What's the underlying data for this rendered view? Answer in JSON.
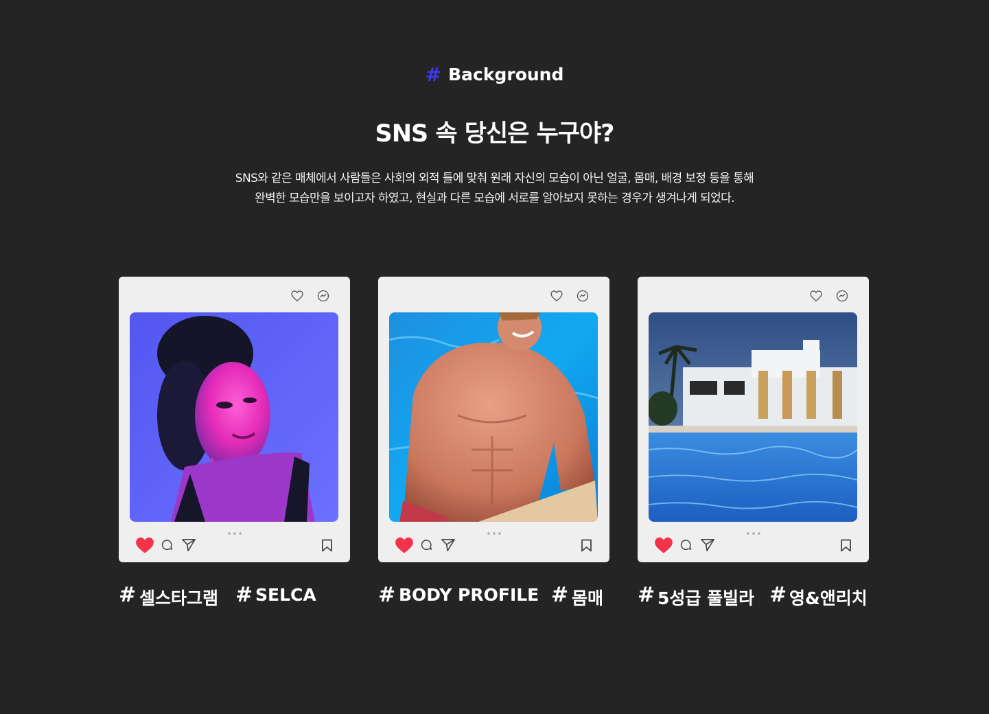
{
  "section": {
    "hash": "#",
    "label": "Background"
  },
  "headline": "SNS 속 당신은 누구야?",
  "description": {
    "line1": "SNS와 같은 매체에서 사람들은 사회의 외적 틀에 맞춰 원래 자신의 모습이 아닌 얼굴, 몸매, 배경 보정 등을 통해",
    "line2": "완벽한 모습만을 보이고자 하였고, 현실과 다른 모습에 서로를 알아보지 못하는 경우가 생겨나게 되었다."
  },
  "cards": [
    {
      "photo": "selfie-portrait-photo",
      "tags": [
        "셀스타그램",
        "SELCA"
      ],
      "hash": "#"
    },
    {
      "photo": "body-profile-pool-photo",
      "tags": [
        "BODY PROFILE",
        "몸매"
      ],
      "hash": "#"
    },
    {
      "photo": "pool-villa-photo",
      "tags": [
        "5성급 풀빌라",
        "영&앤리치"
      ],
      "hash": "#"
    }
  ],
  "colors": {
    "background": "#242424",
    "accent": "#3a3af0",
    "card": "#efefef",
    "like": "#f2334a"
  },
  "icons": [
    "heart-outline-icon",
    "messenger-icon",
    "like-heart-icon",
    "comment-icon",
    "share-icon",
    "bookmark-icon",
    "more-dots-icon"
  ]
}
